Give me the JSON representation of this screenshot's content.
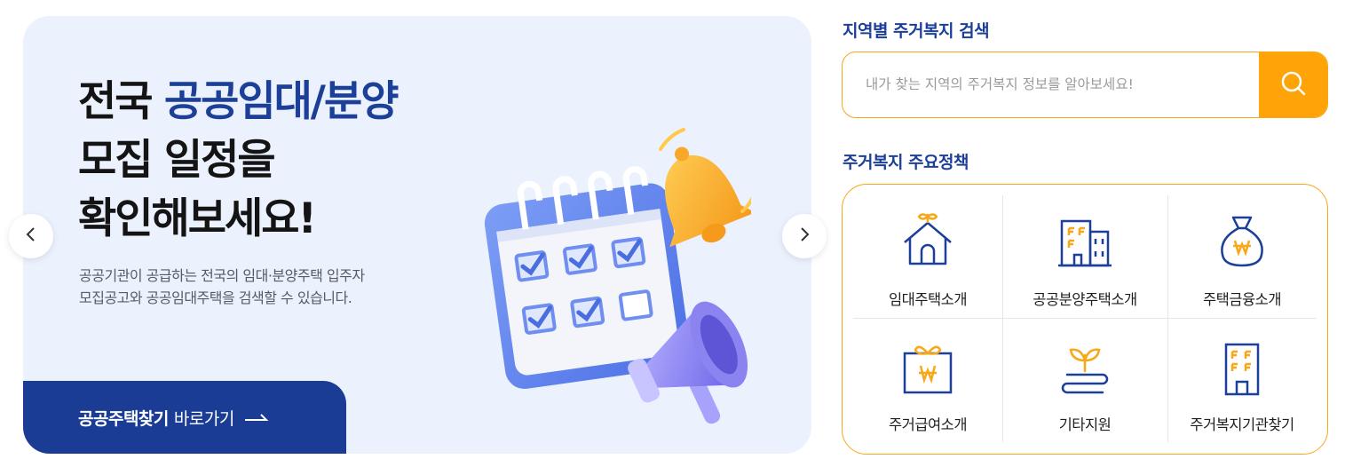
{
  "banner": {
    "title_line1_prefix": "전국 ",
    "title_line1_highlight": "공공임대/분양",
    "title_line2": "모집 일정을",
    "title_line3": "확인해보세요!",
    "description": "공공기관이 공급하는 전국의 임대·분양주택 입주자 모집공고와 공공임대주택을 검색할 수 있습니다.",
    "button_bold": "공공주택찾기",
    "button_rest": "바로가기"
  },
  "search": {
    "title": "지역별 주거복지 검색",
    "placeholder": "내가 찾는 지역의 주거복지 정보를 알아보세요!"
  },
  "policy": {
    "title": "주거복지 주요정책",
    "items": [
      {
        "label": "임대주택소개",
        "icon": "house-icon"
      },
      {
        "label": "공공분양주택소개",
        "icon": "buildings-icon"
      },
      {
        "label": "주택금융소개",
        "icon": "money-bag-icon"
      },
      {
        "label": "주거급여소개",
        "icon": "gift-won-icon"
      },
      {
        "label": "기타지원",
        "icon": "sprout-icon"
      },
      {
        "label": "주거복지기관찾기",
        "icon": "office-building-icon"
      }
    ]
  },
  "colors": {
    "brand_blue": "#1c3f98",
    "accent_orange": "#fea308",
    "banner_bg": "#ebf1fd"
  }
}
